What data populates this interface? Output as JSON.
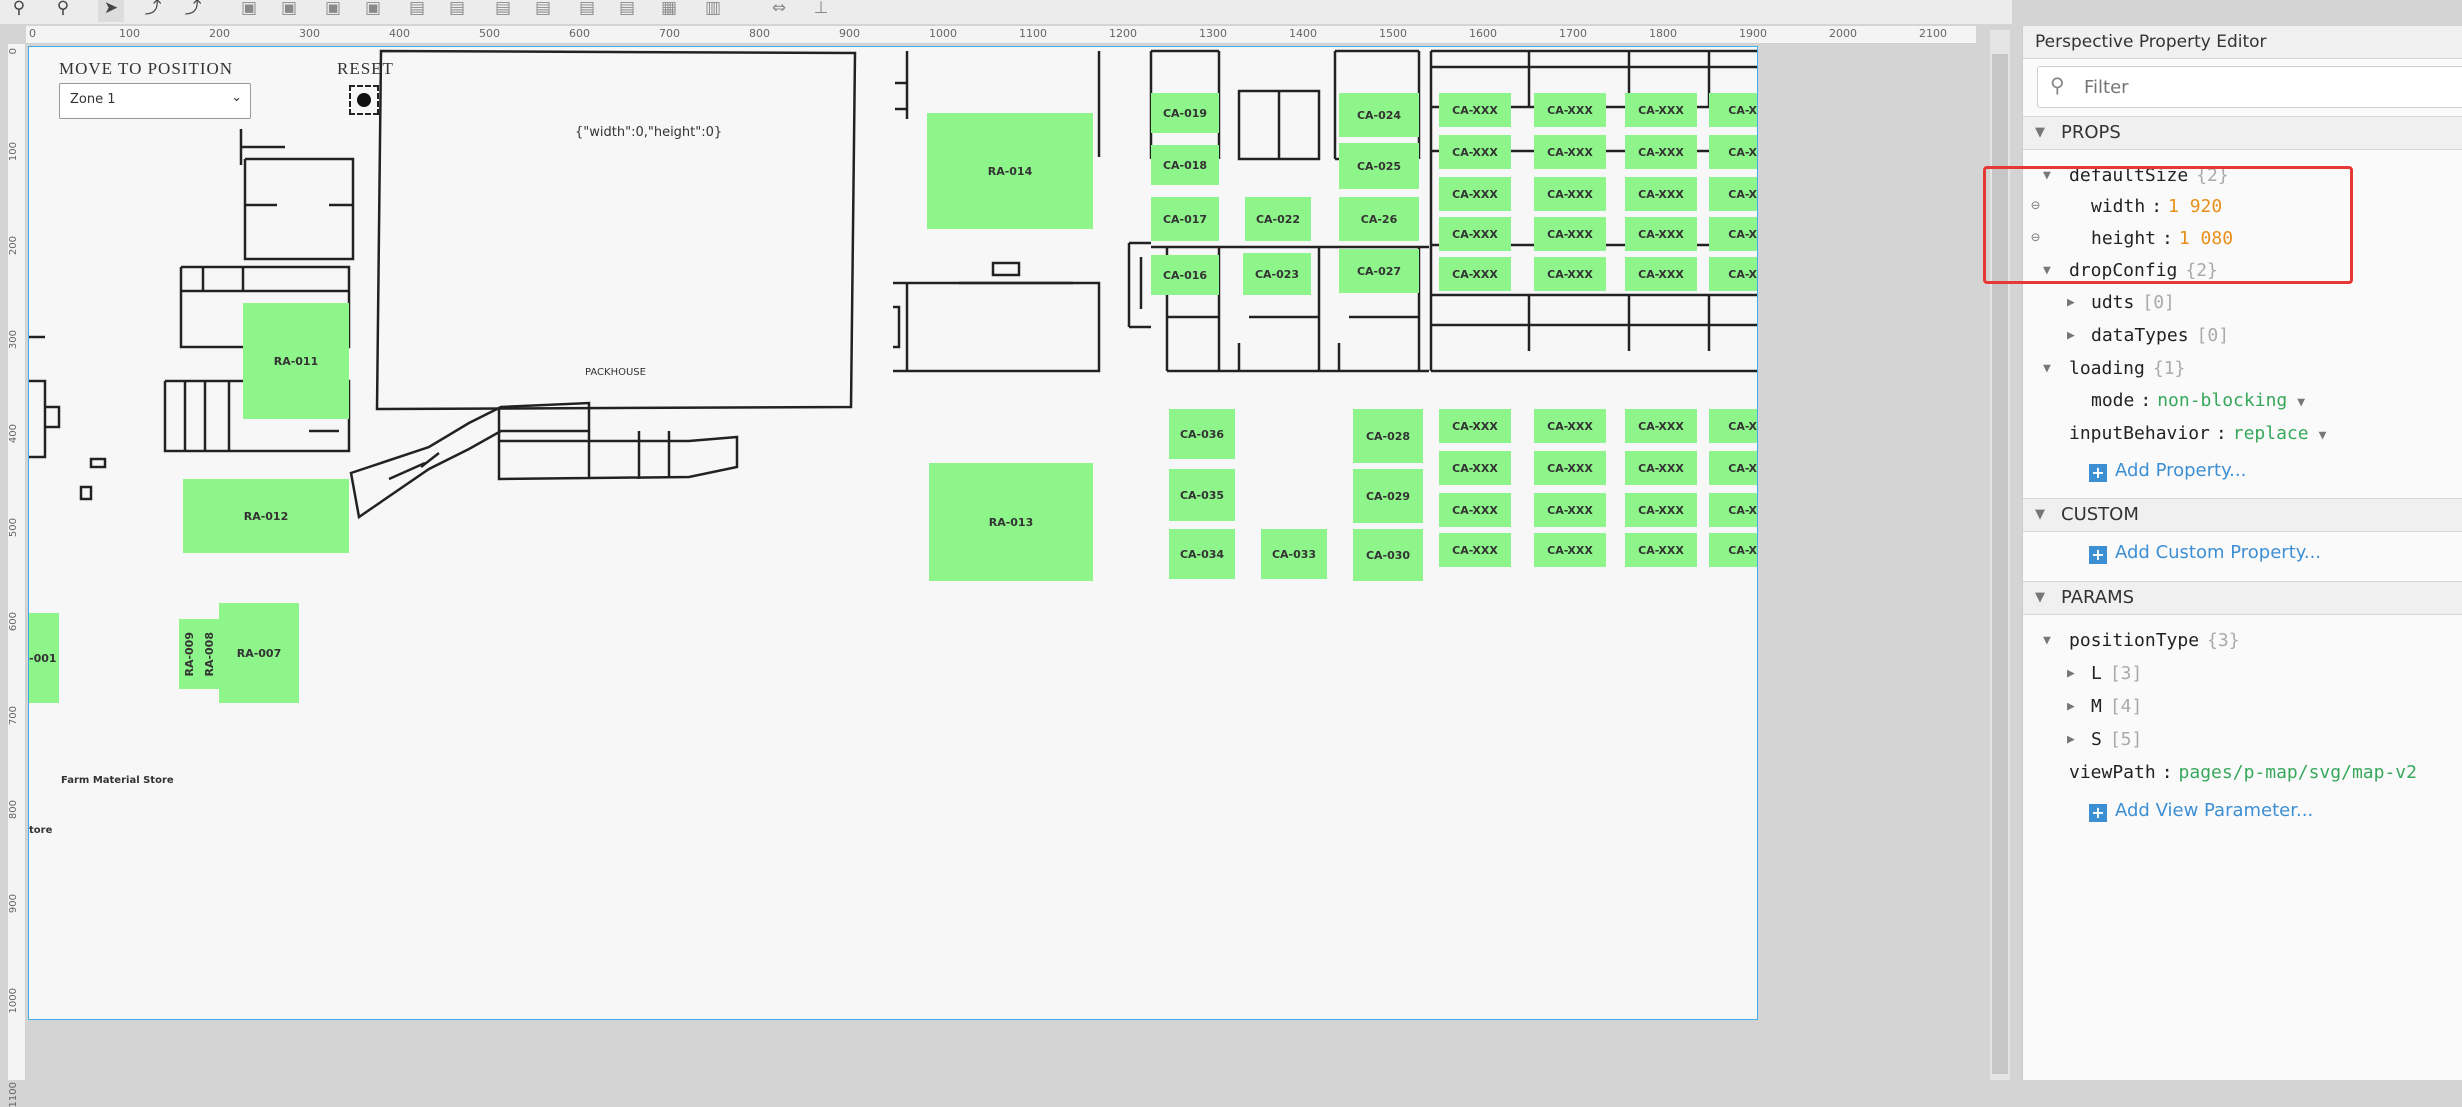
{
  "ruler": {
    "top": [
      "0",
      "100",
      "200",
      "300",
      "400",
      "500",
      "600",
      "700",
      "800",
      "900",
      "1000",
      "1100",
      "1200",
      "1300",
      "1400",
      "1500",
      "1600",
      "1700",
      "1800",
      "1900",
      "2000",
      "2100"
    ],
    "left": [
      "0",
      "100",
      "200",
      "300",
      "400",
      "500",
      "600",
      "700",
      "800",
      "900",
      "1000",
      "1100"
    ]
  },
  "canvas": {
    "move_label": "MOVE TO POSITION",
    "reset_label": "RESET",
    "zone_select": "Zone 1",
    "size_text": "{\"width\":0,\"height\":0}",
    "packhouse": "PACKHOUSE",
    "farm_store": "Farm Material Store",
    "store_partial": "tore",
    "zones": {
      "ra014": "RA-014",
      "ra011": "RA-011",
      "ra012": "RA-012",
      "ra013": "RA-013",
      "ra007": "RA-007",
      "ra009": "RA-009",
      "ra008": "RA-008",
      "ra001": "-001",
      "ca019": "CA-019",
      "ca018": "CA-018",
      "ca017": "CA-017",
      "ca016": "CA-016",
      "ca022": "CA-022",
      "ca023": "CA-023",
      "ca024": "CA-024",
      "ca025": "CA-025",
      "ca26": "CA-26",
      "ca027": "CA-027",
      "ca036": "CA-036",
      "ca035": "CA-035",
      "ca034": "CA-034",
      "ca033": "CA-033",
      "ca028": "CA-028",
      "ca029": "CA-029",
      "ca030": "CA-030",
      "caxxx": "CA-XXX",
      "cax": "CA-X"
    }
  },
  "panel": {
    "title": "Perspective Property Editor",
    "filter_placeholder": "Filter",
    "props_section": "PROPS",
    "custom_section": "CUSTOM",
    "params_section": "PARAMS",
    "defaultSize": {
      "key": "defaultSize",
      "count": "{2}",
      "width_key": "width",
      "width_val": "1 920",
      "height_key": "height",
      "height_val": "1 080"
    },
    "dropConfig": {
      "key": "dropConfig",
      "count": "{2}",
      "udts": "udts",
      "udts_count": "[0]",
      "dataTypes": "dataTypes",
      "dataTypes_count": "[0]"
    },
    "loading": {
      "key": "loading",
      "count": "{1}",
      "mode_key": "mode",
      "mode_val": "non-blocking"
    },
    "inputBehavior": {
      "key": "inputBehavior",
      "val": "replace"
    },
    "add_property": "Add Property...",
    "add_custom": "Add Custom Property...",
    "positionType": {
      "key": "positionType",
      "count": "{3}",
      "L": "L",
      "L_count": "[3]",
      "M": "M",
      "M_count": "[4]",
      "S": "S",
      "S_count": "[5]"
    },
    "viewPath": {
      "key": "viewPath",
      "val": "pages/p-map/svg/map-v2"
    },
    "add_view_param": "Add View Parameter..."
  },
  "colors": {
    "zone": "#8ef58a",
    "accent": "#3d8fd4",
    "highlight": "#e53935",
    "number": "#e88f1a",
    "string": "#37a85b"
  }
}
